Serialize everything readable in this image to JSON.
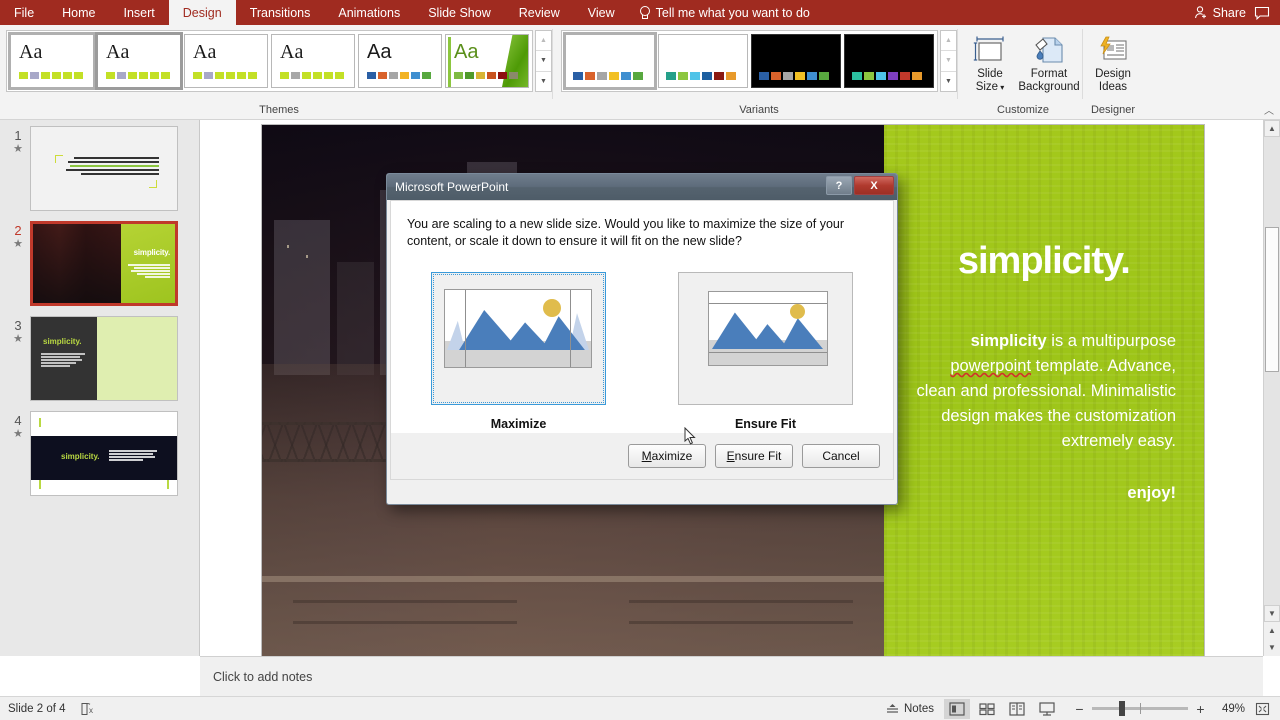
{
  "ribbon": {
    "tabs": [
      {
        "label": "File",
        "active": false
      },
      {
        "label": "Home",
        "active": false
      },
      {
        "label": "Insert",
        "active": false
      },
      {
        "label": "Design",
        "active": true
      },
      {
        "label": "Transitions",
        "active": false
      },
      {
        "label": "Animations",
        "active": false
      },
      {
        "label": "Slide Show",
        "active": false
      },
      {
        "label": "Review",
        "active": false
      },
      {
        "label": "View",
        "active": false
      }
    ],
    "tell_me": "Tell me what you want to do",
    "share_label": "Share",
    "groups": {
      "themes_label": "Themes",
      "variants_label": "Variants",
      "customize_label": "Customize",
      "designer_label": "Designer"
    },
    "theme_thumbs": [
      {
        "aa": "Aa",
        "selected": false,
        "swatches": [
          "#c3e026",
          "#a8a8c8",
          "#c3e026",
          "#c3e026",
          "#c3e026",
          "#c3e026"
        ]
      },
      {
        "aa": "Aa",
        "selected": true,
        "swatches": [
          "#c3e026",
          "#a8a8c8",
          "#c3e026",
          "#c3e026",
          "#c3e026",
          "#c3e026"
        ]
      },
      {
        "aa": "Aa",
        "selected": false,
        "swatches": [
          "#c3e026",
          "#a8a8c8",
          "#c3e026",
          "#c3e026",
          "#c3e026",
          "#c3e026"
        ]
      },
      {
        "aa": "Aa",
        "selected": false,
        "swatches": [
          "#c3e026",
          "#a8a8a8",
          "#c3e026",
          "#c3e026",
          "#c3e026",
          "#c3e026"
        ]
      },
      {
        "aa": "Aa",
        "selected": false,
        "swatches": [
          "#2a5fa5",
          "#d9622b",
          "#a6a6a6",
          "#f2b324",
          "#3f8fd0",
          "#58a83f"
        ]
      },
      {
        "aa": "Aa",
        "selected": false,
        "swatches": [
          "#7fbb42",
          "#4f9a2a",
          "#d8b434",
          "#c9531f",
          "#8e1010",
          "#8a8a6a"
        ]
      }
    ],
    "variant_thumbs": [
      {
        "dark": false,
        "selected": true,
        "swatches": [
          "#2a5fa5",
          "#d9622b",
          "#a6a6a6",
          "#f2c024",
          "#3f8fd0",
          "#58a83f"
        ]
      },
      {
        "dark": false,
        "selected": false,
        "swatches": [
          "#25a08a",
          "#8cc63f",
          "#4fc3e8",
          "#1d5fa0",
          "#8b1a12",
          "#e89a2b"
        ]
      },
      {
        "dark": true,
        "selected": false,
        "swatches": [
          "#2a5fa5",
          "#d9622b",
          "#a6a6a6",
          "#f2c024",
          "#3f8fd0",
          "#58a83f"
        ]
      },
      {
        "dark": true,
        "selected": false,
        "swatches": [
          "#2bc0a0",
          "#8cc63f",
          "#4fc3e8",
          "#7d3fc0",
          "#c0392b",
          "#e89a2b"
        ]
      }
    ],
    "slide_size_label_1": "Slide",
    "slide_size_label_2": "Size",
    "format_bg_label_1": "Format",
    "format_bg_label_2": "Background",
    "design_ideas_label_1": "Design",
    "design_ideas_label_2": "Ideas"
  },
  "thumbnails": [
    {
      "num": "1",
      "selected": false
    },
    {
      "num": "2",
      "selected": true
    },
    {
      "num": "3",
      "selected": false
    },
    {
      "num": "4",
      "selected": false
    }
  ],
  "slide": {
    "title": "simplicity.",
    "body_bold": "simplicity",
    "body_rest_1": " is a multipurpose ",
    "body_squiggly": "powerpoint",
    "body_rest_2": " template. Advance, clean and professional. Minimalistic design makes the customization extremely easy.",
    "enjoy": "enjoy!",
    "green_color": "#a3c81c"
  },
  "notes": {
    "placeholder": "Click to add notes"
  },
  "status": {
    "slide_indicator": "Slide 2 of 4",
    "notes_label": "Notes",
    "zoom_percent": "49%"
  },
  "dialog": {
    "title": "Microsoft PowerPoint",
    "message": "You are scaling to a new slide size.  Would you like to maximize the size of your content, or scale it down to ensure it will fit on the new slide?",
    "option_maximize": "Maximize",
    "option_ensure_fit": "Ensure Fit",
    "btn_maximize": "Maximize",
    "btn_maximize_accel": "M",
    "btn_maximize_rest": "aximize",
    "btn_ensure_fit_accel": "E",
    "btn_ensure_fit_rest": "nsure Fit",
    "btn_cancel": "Cancel",
    "help_glyph": "?",
    "close_glyph": "X"
  }
}
